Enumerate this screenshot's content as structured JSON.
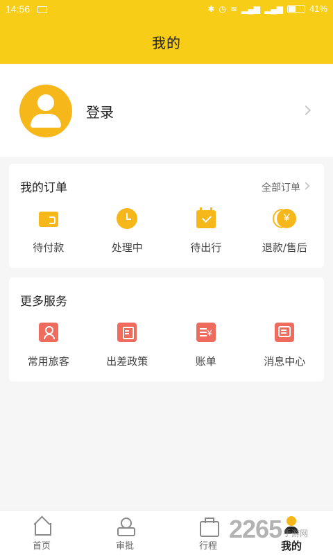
{
  "status_bar": {
    "time": "14:56",
    "battery": "41%"
  },
  "header": {
    "title": "我的"
  },
  "profile": {
    "login_label": "登录"
  },
  "orders": {
    "title": "我的订单",
    "all_link": "全部订单",
    "items": [
      {
        "label": "待付款",
        "icon": "wallet-icon"
      },
      {
        "label": "处理中",
        "icon": "clock-icon"
      },
      {
        "label": "待出行",
        "icon": "calendar-check-icon"
      },
      {
        "label": "退款/售后",
        "icon": "refund-yen-icon"
      }
    ]
  },
  "services": {
    "title": "更多服务",
    "items": [
      {
        "label": "常用旅客",
        "icon": "traveler-icon"
      },
      {
        "label": "出差政策",
        "icon": "policy-doc-icon"
      },
      {
        "label": "账单",
        "icon": "bill-icon"
      },
      {
        "label": "消息中心",
        "icon": "message-icon"
      }
    ]
  },
  "tabs": [
    {
      "label": "首页",
      "icon": "home-icon"
    },
    {
      "label": "审批",
      "icon": "approve-icon"
    },
    {
      "label": "行程",
      "icon": "suitcase-icon"
    },
    {
      "label": "我的",
      "icon": "user-icon",
      "active": true
    }
  ],
  "watermark": {
    "number": "2265",
    "text": "手游网"
  },
  "colors": {
    "brand_yellow": "#f7cd17",
    "icon_yellow": "#f5b71a",
    "service_red": "#ee6b5e"
  }
}
